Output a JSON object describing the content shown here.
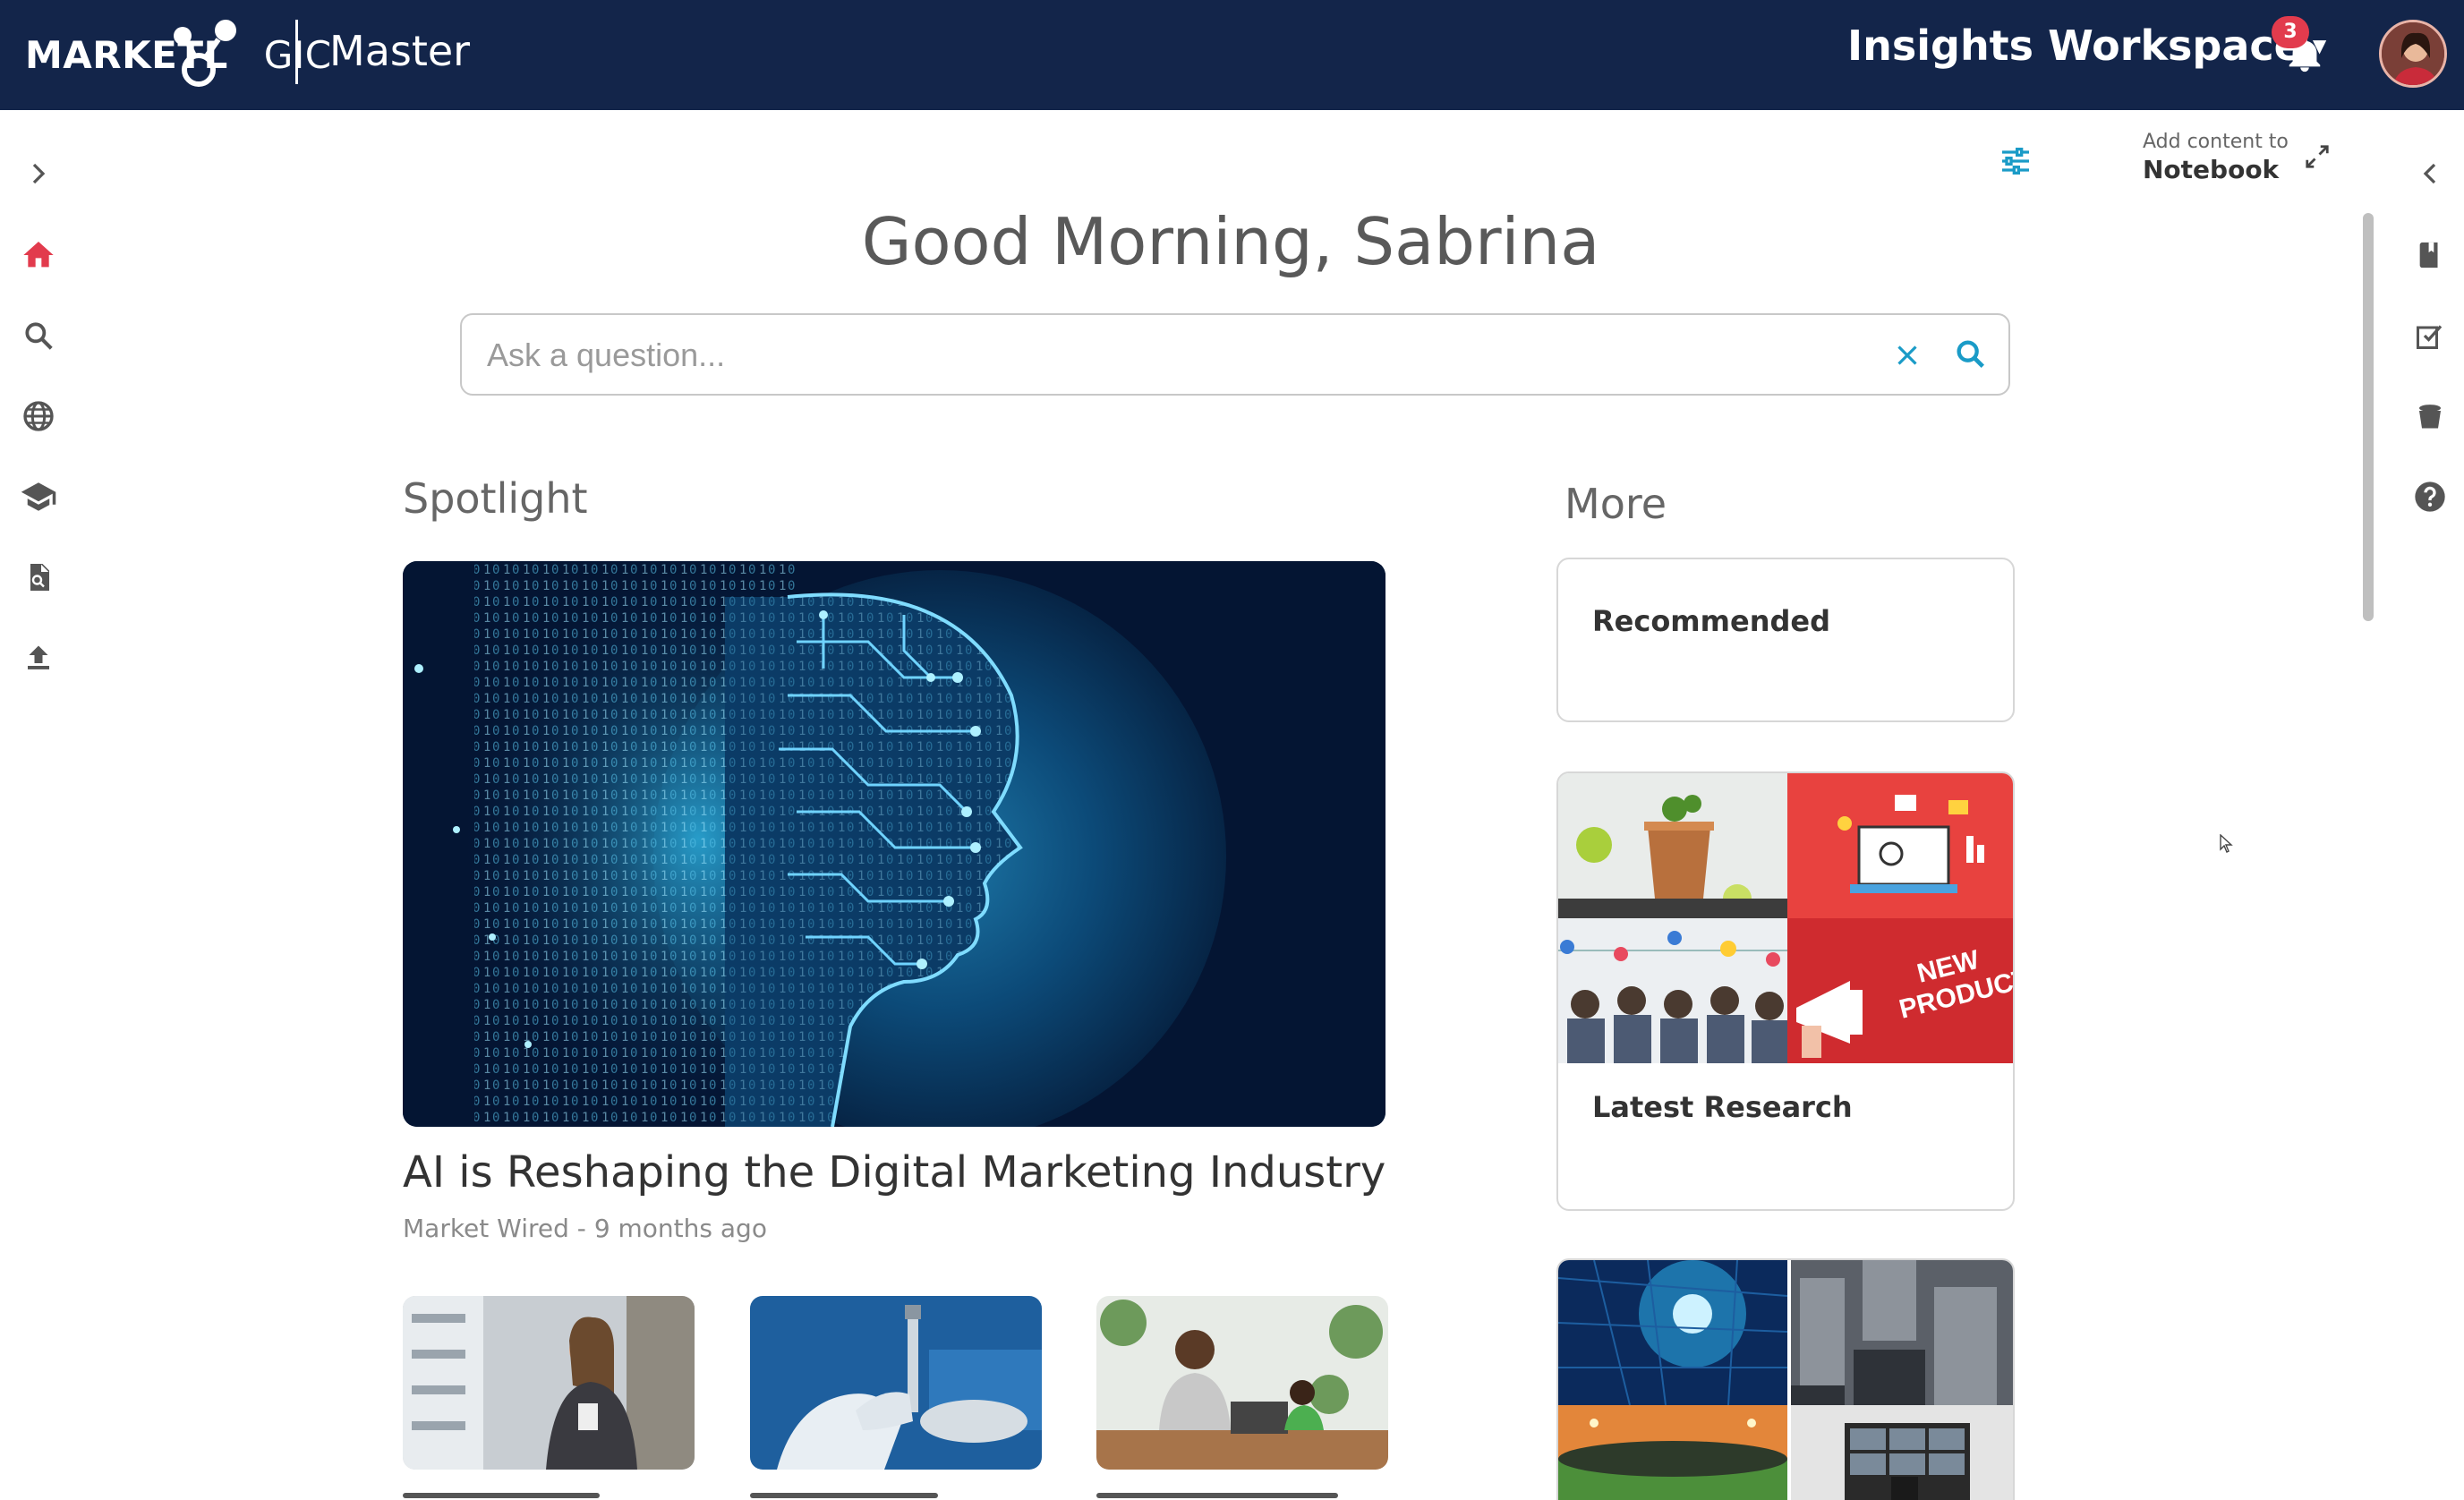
{
  "header": {
    "logo_bold": "MARKETL",
    "logo_light": "GIC",
    "sub_brand": "Master",
    "workspace_label": "Insights Workspace",
    "notification_count": "3"
  },
  "left_nav": [
    {
      "id": "expand",
      "icon": "chevron-right-icon"
    },
    {
      "id": "home",
      "icon": "home-icon",
      "active": true
    },
    {
      "id": "search",
      "icon": "search-icon"
    },
    {
      "id": "globe",
      "icon": "globe-icon"
    },
    {
      "id": "learning",
      "icon": "graduation-cap-icon"
    },
    {
      "id": "reports",
      "icon": "report-document-icon"
    },
    {
      "id": "upload",
      "icon": "upload-icon"
    }
  ],
  "right_nav": [
    {
      "id": "collapse",
      "icon": "chevron-left-icon"
    },
    {
      "id": "notebook",
      "icon": "notebook-icon"
    },
    {
      "id": "tasks",
      "icon": "checklist-icon"
    },
    {
      "id": "archive",
      "icon": "bucket-icon"
    },
    {
      "id": "help",
      "icon": "help-icon"
    }
  ],
  "notebook": {
    "prefix": "Add content to",
    "name": "Notebook"
  },
  "greeting": "Good Morning, Sabrina",
  "search": {
    "placeholder": "Ask a question...",
    "value": ""
  },
  "spotlight": {
    "section_title": "Spotlight",
    "title": "AI is Reshaping the Digital Marketing Industry",
    "source": "Market Wired",
    "separator": " - ",
    "age": "9 months ago"
  },
  "more": {
    "section_title": "More",
    "cards": [
      {
        "title": "Recommended"
      },
      {
        "title": "Latest Research"
      },
      {
        "title": ""
      }
    ]
  },
  "colors": {
    "header_bg": "#13254a",
    "accent": "#1a9bc7",
    "active_nav": "#e23b4d"
  }
}
